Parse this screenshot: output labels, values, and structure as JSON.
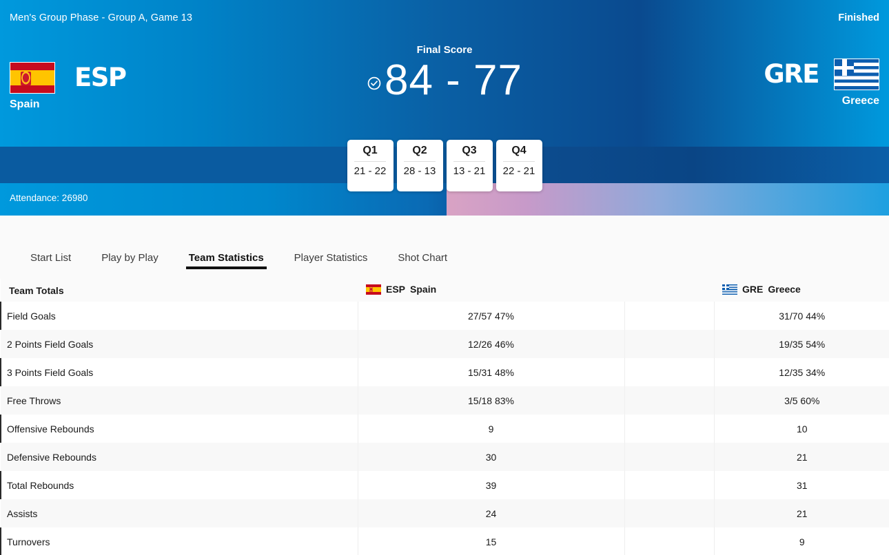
{
  "header": {
    "title": "Men's Group Phase - Group A, Game 13",
    "status": "Finished",
    "final_label": "Final Score",
    "final_score": "84 - 77",
    "attendance": "Attendance: 26980",
    "check_icon": "check-circle-icon",
    "home": {
      "abbr": "ESP",
      "name": "Spain",
      "flag": "spain-flag"
    },
    "away": {
      "abbr": "GRE",
      "name": "Greece",
      "flag": "greece-flag"
    }
  },
  "quarters": [
    {
      "label": "Q1",
      "score": "21 - 22"
    },
    {
      "label": "Q2",
      "score": "28 - 13"
    },
    {
      "label": "Q3",
      "score": "13 - 21"
    },
    {
      "label": "Q4",
      "score": "22 - 21"
    }
  ],
  "tabs": [
    {
      "label": "Start List",
      "active": false
    },
    {
      "label": "Play by Play",
      "active": false
    },
    {
      "label": "Team Statistics",
      "active": true
    },
    {
      "label": "Player Statistics",
      "active": false
    },
    {
      "label": "Shot Chart",
      "active": false
    }
  ],
  "table": {
    "headers": {
      "label": "Team Totals",
      "home_abbr": "ESP",
      "home_name": "Spain",
      "away_abbr": "GRE",
      "away_name": "Greece"
    },
    "rows": [
      {
        "label": "Field Goals",
        "home": "27/57 47%",
        "away": "31/70 44%"
      },
      {
        "label": "2 Points Field Goals",
        "home": "12/26 46%",
        "away": "19/35 54%"
      },
      {
        "label": "3 Points Field Goals",
        "home": "15/31 48%",
        "away": "12/35 34%"
      },
      {
        "label": "Free Throws",
        "home": "15/18 83%",
        "away": "3/5 60%"
      },
      {
        "label": "Offensive Rebounds",
        "home": "9",
        "away": "10"
      },
      {
        "label": "Defensive Rebounds",
        "home": "30",
        "away": "21"
      },
      {
        "label": "Total Rebounds",
        "home": "39",
        "away": "31"
      },
      {
        "label": "Assists",
        "home": "24",
        "away": "21"
      },
      {
        "label": "Turnovers",
        "home": "15",
        "away": "9"
      }
    ]
  },
  "colors": {
    "brand_light_blue": "#0099dd",
    "brand_dark_blue": "#0a4a8f",
    "accent_black": "#111111",
    "row_alt": "#f8f8f8"
  }
}
